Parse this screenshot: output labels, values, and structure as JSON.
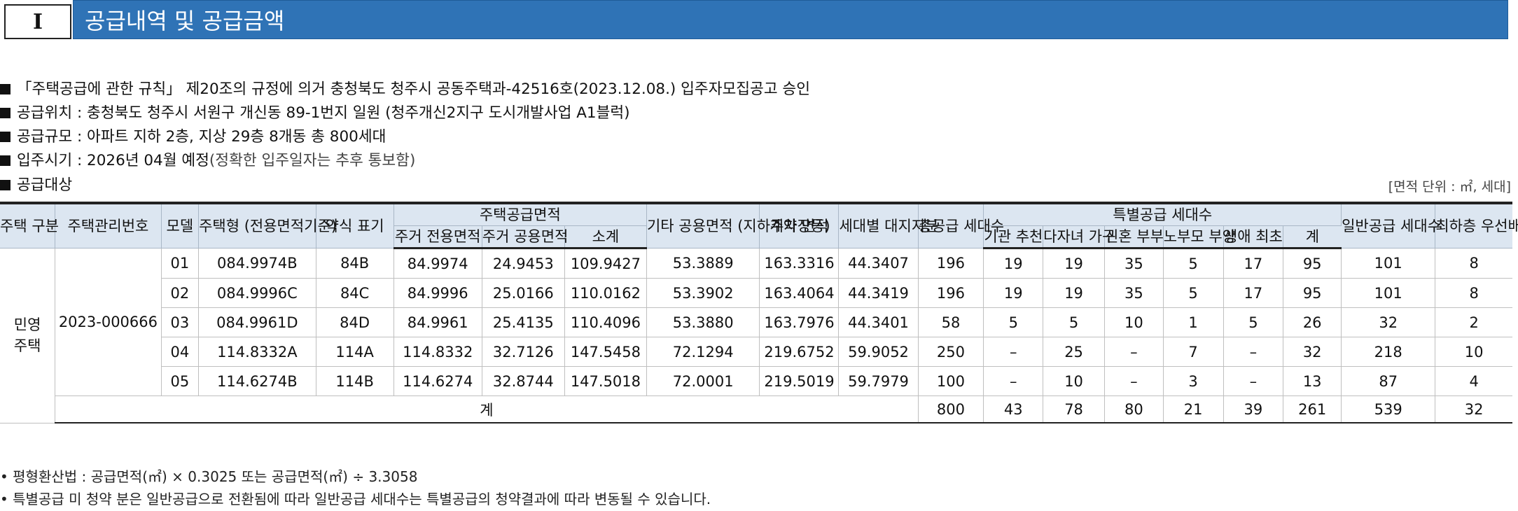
{
  "section": {
    "number": "I",
    "title": "공급내역 및 공급금액"
  },
  "bullets": [
    "「주택공급에 관한 규칙」 제20조의 규정에 의거 충청북도 청주시 공동주택과-42516호(2023.12.08.) 입주자모집공고 승인",
    "공급위치 : 충청북도 청주시 서원구 개신동 89-1번지 일원 (청주개신2지구 도시개발사업 A1블럭)",
    "공급규모 : 아파트 지하 2층, 지상 29층 8개동 총 800세대",
    "입주시기 : 2026년 04월 예정",
    "공급대상"
  ],
  "bullet_move_note": "(정확한 입주일자는 추후 통보함)",
  "unit_label": "[면적 단위 : ㎡, 세대]",
  "table": {
    "headers": {
      "housing_type": "주택 구분",
      "mgmt_no": "주택관리번호",
      "model": "모델",
      "house_type": "주택형 (전용면적기준)",
      "abbr": "약식 표기",
      "supply_area": "주택공급면적",
      "exclusive": "주거 전용면적",
      "common": "주거 공용면적",
      "subtotal": "소계",
      "other_common": "기타 공용면적 (지하주차장등)",
      "contract": "계약 면적",
      "land": "세대별 대지지분",
      "total_units": "총공급 세대수",
      "special": "특별공급 세대수",
      "sp_inst": "기관 추천",
      "sp_multi": "다자녀 가구",
      "sp_newly": "신혼 부부",
      "sp_parent": "노부모 부양",
      "sp_first": "생애 최초",
      "sp_sum": "계",
      "general": "일반공급 세대수",
      "lowest": "최하층 우선배정 세대수"
    },
    "group_type": "민영 주택",
    "mgmt_number": "2023-000666",
    "rows": [
      [
        "01",
        "084.9974B",
        "84B",
        "84.9974",
        "24.9453",
        "109.9427",
        "53.3889",
        "163.3316",
        "44.3407",
        "196",
        "19",
        "19",
        "35",
        "5",
        "17",
        "95",
        "101",
        "8"
      ],
      [
        "02",
        "084.9996C",
        "84C",
        "84.9996",
        "25.0166",
        "110.0162",
        "53.3902",
        "163.4064",
        "44.3419",
        "196",
        "19",
        "19",
        "35",
        "5",
        "17",
        "95",
        "101",
        "8"
      ],
      [
        "03",
        "084.9961D",
        "84D",
        "84.9961",
        "25.4135",
        "110.4096",
        "53.3880",
        "163.7976",
        "44.3401",
        "58",
        "5",
        "5",
        "10",
        "1",
        "5",
        "26",
        "32",
        "2"
      ],
      [
        "04",
        "114.8332A",
        "114A",
        "114.8332",
        "32.7126",
        "147.5458",
        "72.1294",
        "219.6752",
        "59.9052",
        "250",
        "–",
        "25",
        "–",
        "7",
        "–",
        "32",
        "218",
        "10"
      ],
      [
        "05",
        "114.6274B",
        "114B",
        "114.6274",
        "32.8744",
        "147.5018",
        "72.0001",
        "219.5019",
        "59.7979",
        "100",
        "–",
        "10",
        "–",
        "3",
        "–",
        "13",
        "87",
        "4"
      ]
    ],
    "total_label": "계",
    "totals": [
      "800",
      "43",
      "78",
      "80",
      "21",
      "39",
      "261",
      "539",
      "32"
    ]
  },
  "notes": [
    "• 평형환산법 : 공급면적(㎡) × 0.3025 또는 공급면적(㎡) ÷ 3.3058",
    "• 특별공급 미 청약 분은 일반공급으로 전환됨에 따라 일반공급 세대수는 특별공급의 청약결과에 따라 변동될 수 있습니다."
  ]
}
